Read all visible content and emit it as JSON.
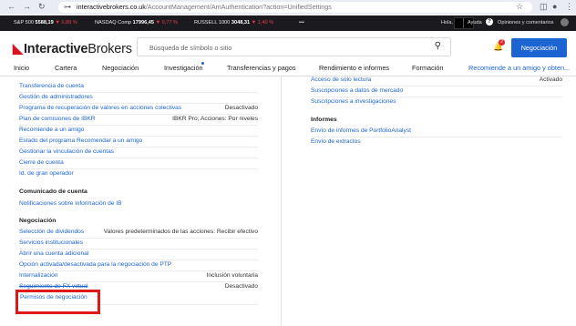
{
  "browser": {
    "url_host": "interactivebrokers.co.uk",
    "url_path": "/AccountManagement/AmAuthentication?action=UnifiedSettings"
  },
  "ticker": {
    "items": [
      {
        "name": "S&P 500",
        "value": "5588,19",
        "change": "▼ 0,89 %"
      },
      {
        "name": "NASDAQ Comp",
        "value": "17996,45",
        "change": "▼ 0,77 %"
      },
      {
        "name": "RUSSELL 1000",
        "value": "3048,31",
        "change": "▼ 1,40 %"
      }
    ],
    "more": "•••",
    "hola": "Hola,",
    "ayuda": "Ayuda",
    "opiniones": "Opiniones y comentarios"
  },
  "header": {
    "logo_bold": "Interactive",
    "logo_light": "Brokers",
    "search_placeholder": "Búsqueda de símbolo o sitio",
    "notification_count": "2",
    "notif_button": "Negociación"
  },
  "nav": {
    "items": [
      "Inicio",
      "Cartera",
      "Negociación",
      "Investigación",
      "Transferencias y pagos",
      "Rendimiento e informes",
      "Formación",
      "Recomiende a un amigo y obten..."
    ]
  },
  "left": {
    "rows_top": [
      {
        "label": "Transferencia de cuenta",
        "value": ""
      },
      {
        "label": "Gestión de administradores",
        "value": ""
      },
      {
        "label": "Programa de recuperación de valores en acciones colectivas",
        "value": "Desactivado"
      },
      {
        "label": "Plan de comisiones de IBKR",
        "value": "IBKR Pro; Acciones: Por niveles"
      },
      {
        "label": "Recomiende a un amigo",
        "value": ""
      },
      {
        "label": "Estado del programa Recomendar a un amigo",
        "value": ""
      },
      {
        "label": "Gestionar la vinculación de cuentas",
        "value": ""
      },
      {
        "label": "Cierre de cuenta",
        "value": ""
      },
      {
        "label": "Id. de gran operador",
        "value": ""
      }
    ],
    "section_comunicado": "Comunicado de cuenta",
    "rows_comunicado": [
      {
        "label": "Notificaciones sobre información de IB",
        "value": ""
      }
    ],
    "section_negociacion": "Negociación",
    "rows_negociacion": [
      {
        "label": "Selección de dividendos",
        "value": "Valores predeterminados de las acciones: Recibir efectivo"
      },
      {
        "label": "Servicios institucionales",
        "value": ""
      },
      {
        "label": "Abrir una cuenta adicional",
        "value": ""
      },
      {
        "label": "Opción activada/desactivada para la negociación de PTP",
        "value": ""
      },
      {
        "label": "Internalización",
        "value": "Inclusión voluntaria"
      },
      {
        "label": "Seguimiento de FX virtual",
        "value": "Desactivado"
      },
      {
        "label": "Permisos de negociación",
        "value": ""
      }
    ]
  },
  "right": {
    "rows_top": [
      {
        "label": "Acceso de solo lectura",
        "value": "Activado"
      },
      {
        "label": "Suscripciones a datos de mercado",
        "value": ""
      },
      {
        "label": "Suscripciones a investigaciones",
        "value": ""
      }
    ],
    "section_informes": "Informes",
    "rows_informes": [
      {
        "label": "Envío de informes de PortfolioAnalyst",
        "value": ""
      },
      {
        "label": "Envío de extractos",
        "value": ""
      }
    ]
  },
  "colors": {
    "accent": "#1c64d1",
    "highlight": "#e01818",
    "ticker_bg": "#1b1b1f",
    "negative": "#e3424a"
  }
}
